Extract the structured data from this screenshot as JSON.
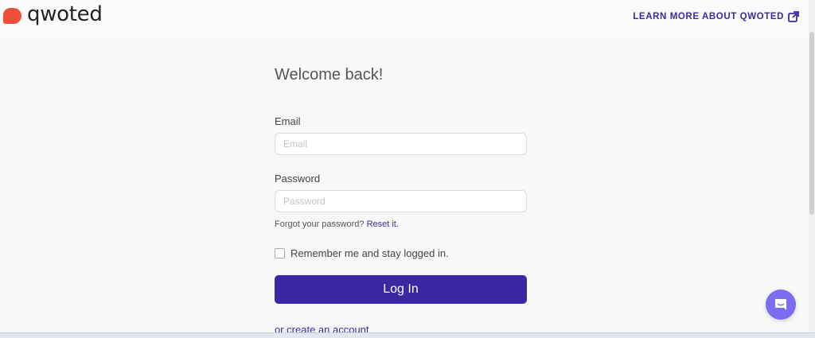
{
  "header": {
    "logo_text": "qwoted",
    "learn_more": "LEARN MORE ABOUT QWOTED",
    "brand_color": "#ef4e37",
    "accent_color": "#3a27a2"
  },
  "form": {
    "title": "Welcome back!",
    "email_label": "Email",
    "email_placeholder": "Email",
    "password_label": "Password",
    "password_placeholder": "Password",
    "forgot_text": "Forgot your password?",
    "reset_link": "Reset it.",
    "remember_label": "Remember me and stay logged in.",
    "login_button": "Log In",
    "create_account": "or create an account"
  },
  "icons": {
    "external": "external-link-icon",
    "chat": "chat-bubble-icon"
  }
}
